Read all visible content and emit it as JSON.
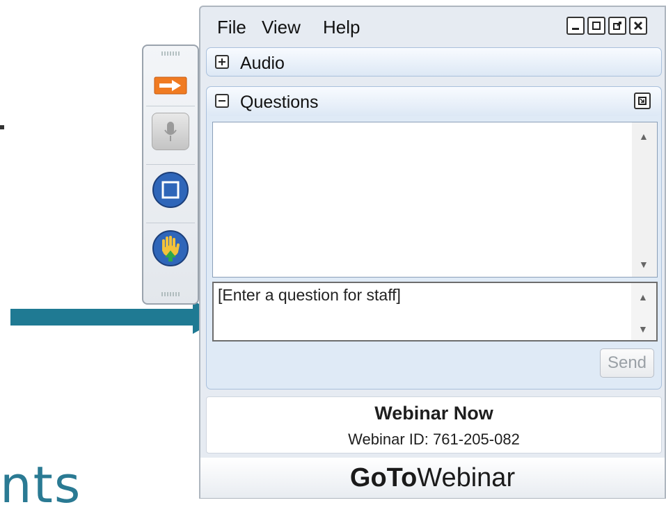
{
  "menu": {
    "file": "File",
    "view": "View",
    "help": "Help"
  },
  "panels": {
    "audio": {
      "title": "Audio"
    },
    "questions": {
      "title": "Questions",
      "input_placeholder": "[Enter a question for staff]",
      "send_label": "Send"
    }
  },
  "webinar": {
    "title": "Webinar Now",
    "id_line": "Webinar ID: 761-205-082"
  },
  "brand": {
    "bold": "GoTo",
    "light": "Webinar"
  },
  "background_text": "nts",
  "colors": {
    "arrow": "#1f7a93",
    "accent_orange": "#f07b22",
    "blue_button": "#2f66b9"
  },
  "toolbar_icons": [
    "arrow-icon",
    "microphone-icon",
    "screen-icon",
    "raise-hand-icon"
  ]
}
